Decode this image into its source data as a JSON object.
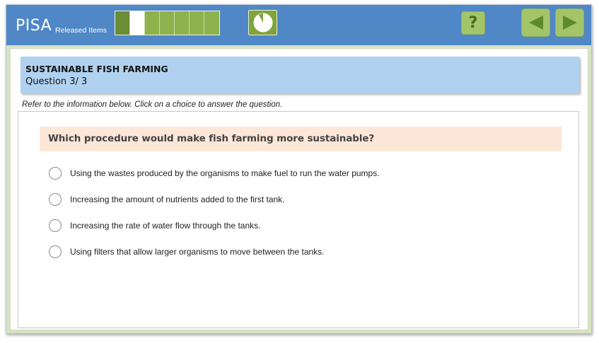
{
  "header": {
    "brand": "PISA",
    "brand_sub": "Released Items",
    "progress": {
      "total": 7,
      "completed": 1,
      "current": 2
    },
    "timer_fraction_remaining": 0.92,
    "help_label": "?",
    "icons": {
      "timer": "clock-timer-icon",
      "help": "question-mark-icon",
      "prev": "arrow-left-icon",
      "next": "arrow-right-icon"
    }
  },
  "question": {
    "unit_title": "SUSTAINABLE FISH FARMING",
    "number_label": "Question 3/ 3",
    "instruction": "Refer to the information below. Click on a choice to answer the question.",
    "stem": "Which procedure would make fish farming more sustainable?",
    "options": [
      "Using the wastes produced by the organisms to make fuel to run the water pumps.",
      "Increasing the amount of nutrients added to the first tank.",
      "Increasing the rate of water flow through the tanks.",
      "Using filters that allow larger organisms to move between the tanks."
    ]
  },
  "colors": {
    "topbar": "#4f87c7",
    "accent_green": "#a4c46a",
    "header_band": "#b0d2f0",
    "stem_band": "#fde7d9"
  }
}
